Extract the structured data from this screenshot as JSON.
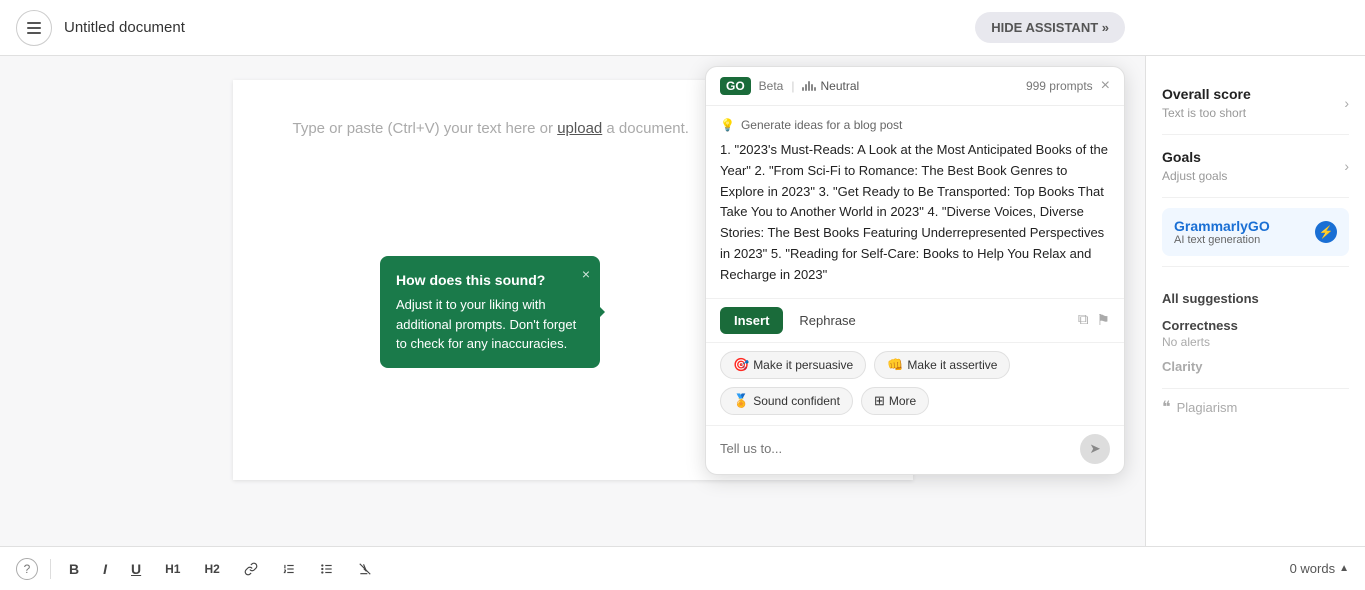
{
  "header": {
    "menu_label": "Menu",
    "doc_title": "Untitled document",
    "hide_assistant_label": "HIDE ASSISTANT »"
  },
  "editor": {
    "placeholder_text": "Type or paste (Ctrl+V) your text here or",
    "upload_link": "upload",
    "placeholder_suffix": "a document."
  },
  "tooltip": {
    "title": "How does this sound?",
    "body": "Adjust it to your liking with additional prompts. Don't forget to check for any inaccuracies.",
    "close": "×"
  },
  "go_panel": {
    "badge": "GO",
    "beta": "Beta",
    "neutral_label": "Neutral",
    "prompts_count": "999 prompts",
    "close": "×",
    "prompt_label": "Generate ideas for a blog post",
    "response_text": "1. \"2023's Must-Reads: A Look at the Most Anticipated Books of the Year\" 2. \"From Sci-Fi to Romance: The Best Book Genres to Explore in 2023\" 3. \"Get Ready to Be Transported: Top Books That Take You to Another World in 2023\" 4. \"Diverse Voices, Diverse Stories: The Best Books Featuring Underrepresented Perspectives in 2023\" 5. \"Reading for Self-Care: Books to Help You Relax and Recharge in 2023\"",
    "insert_btn": "Insert",
    "rephrase_btn": "Rephrase",
    "chip1_emoji": "🎯",
    "chip1_label": "Make it persuasive",
    "chip2_emoji": "👊",
    "chip2_label": "Make it assertive",
    "chip3_emoji": "🏅",
    "chip3_label": "Sound confident",
    "chip4_label": "More",
    "input_placeholder": "Tell us to...",
    "send_icon": "➤"
  },
  "toolbar": {
    "help": "?",
    "bold": "B",
    "italic": "I",
    "underline": "U",
    "h1": "H1",
    "h2": "H2",
    "link": "⌘",
    "ol": "≡",
    "ul": "≡",
    "clear": "⌦",
    "word_count": "0 words",
    "caret": "▲"
  },
  "sidebar": {
    "overall_score_title": "Overall score",
    "overall_score_sub": "Text is too short",
    "goals_title": "Goals",
    "goals_sub": "Adjust goals",
    "grammarly_go_label": "GrammarlyGO",
    "grammarly_go_sub": "AI text generation",
    "all_suggestions_title": "All suggestions",
    "correctness_title": "Correctness",
    "correctness_sub": "No alerts",
    "clarity_title": "Clarity",
    "plagiarism_label": "Plagiarism",
    "icon_go": "⚡"
  }
}
